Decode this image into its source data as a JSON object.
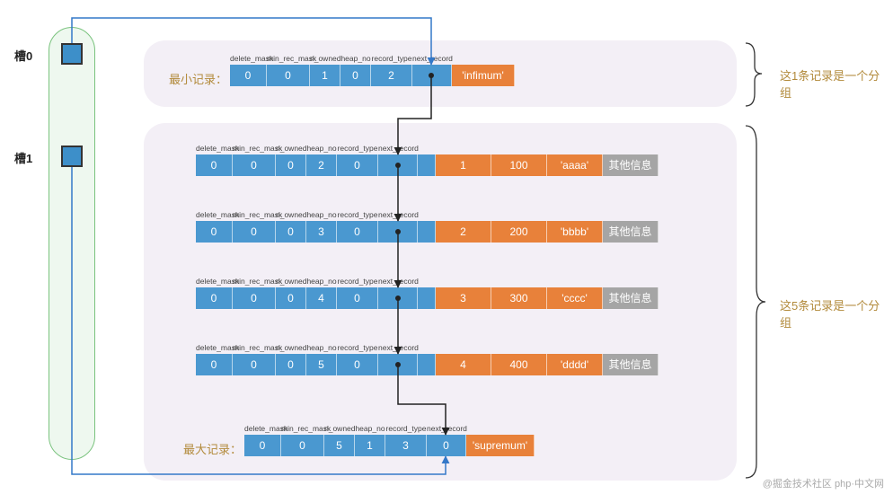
{
  "slot": {
    "label0": "槽0",
    "label1": "槽1"
  },
  "headers": {
    "h1": "delete_mask",
    "h2": "min_rec_mask",
    "h3": "n_owned",
    "h4": "heap_no",
    "h5": "record_type",
    "h6": "next_record"
  },
  "minRecord": {
    "label": "最小记录：",
    "cells": [
      "0",
      "0",
      "1",
      "0",
      "2"
    ],
    "payload": "'infimum'"
  },
  "dataRows": [
    {
      "cells": [
        "0",
        "0",
        "0",
        "2",
        "0"
      ],
      "d": [
        "1",
        "100",
        "'aaaa'"
      ],
      "other": "其他信息"
    },
    {
      "cells": [
        "0",
        "0",
        "0",
        "3",
        "0"
      ],
      "d": [
        "2",
        "200",
        "'bbbb'"
      ],
      "other": "其他信息"
    },
    {
      "cells": [
        "0",
        "0",
        "0",
        "4",
        "0"
      ],
      "d": [
        "3",
        "300",
        "'cccc'"
      ],
      "other": "其他信息"
    },
    {
      "cells": [
        "0",
        "0",
        "0",
        "5",
        "0"
      ],
      "d": [
        "4",
        "400",
        "'dddd'"
      ],
      "other": "其他信息"
    }
  ],
  "maxRecord": {
    "label": "最大记录：",
    "cells": [
      "0",
      "0",
      "5",
      "1",
      "3",
      "0"
    ],
    "payload": "'supremum'"
  },
  "groupNotes": {
    "top": "这1条记录是一个分组",
    "bottom": "这5条记录是一个分组"
  },
  "watermark": "@掘金技术社区  php·中文网"
}
